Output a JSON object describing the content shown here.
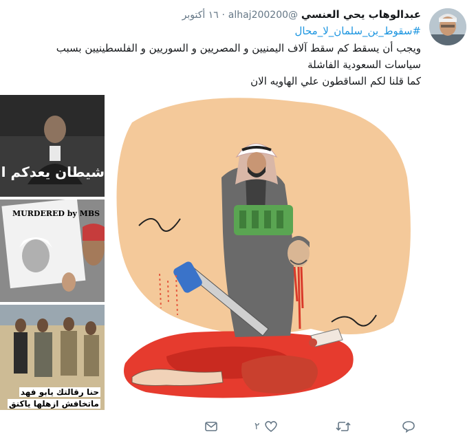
{
  "tweet": {
    "author_name": "عبدالوهاب يحي العنسي",
    "handle": "@alhaj200200",
    "separator": "·",
    "date": "١٦ أكتوبر",
    "hashtag": "#سقوط_بن_سلمان_لا_محال",
    "lines": [
      "ويجب أن يسقط كم سقط آلاف اليمنيين و المصريين و السوريين و الفلسطينيين بسبب",
      "سياسات السعودية الفاشلة",
      "كما قلنا لكم الساقطون علي الهاويه الان"
    ],
    "image_texts": {
      "top": "شيطان يعدكم الف",
      "middle_sign": "MURDERED by MBS",
      "bottom_line1": "حنا رقالتك يابو فهد",
      "bottom_line2": "ماتخافش ازهلها ياكنق"
    }
  },
  "actions": {
    "reply_icon": "reply-icon",
    "retweet_icon": "retweet-icon",
    "like_icon": "heart-icon",
    "like_count": "٢",
    "dm_icon": "envelope-icon"
  },
  "colors": {
    "link": "#1b95e0",
    "muted": "#657786",
    "text": "#14171a"
  }
}
